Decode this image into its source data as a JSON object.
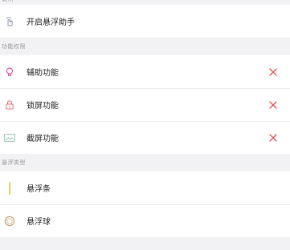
{
  "sections": [
    {
      "header": "说明",
      "items": [
        {
          "label": "开启悬浮助手",
          "icon": "touch-icon"
        }
      ]
    },
    {
      "header": "功能权限",
      "items": [
        {
          "label": "辅助功能",
          "icon": "bulb-icon",
          "removable": true
        },
        {
          "label": "锁屏功能",
          "icon": "lock-icon",
          "removable": true
        },
        {
          "label": "截屏功能",
          "icon": "screenshot-icon",
          "removable": true
        }
      ]
    },
    {
      "header": "悬浮类型",
      "items": [
        {
          "label": "悬浮条",
          "icon": "bar-icon"
        },
        {
          "label": "悬浮球",
          "icon": "ball-icon"
        }
      ]
    }
  ],
  "colors": {
    "remove": "#e35050",
    "bulb": "#d94f9a",
    "lock": "#e0707a",
    "screenshot": "#9bc9b6",
    "bar": "#e2c340",
    "ball": "#caa77a",
    "touch": "#8a8fb0"
  }
}
